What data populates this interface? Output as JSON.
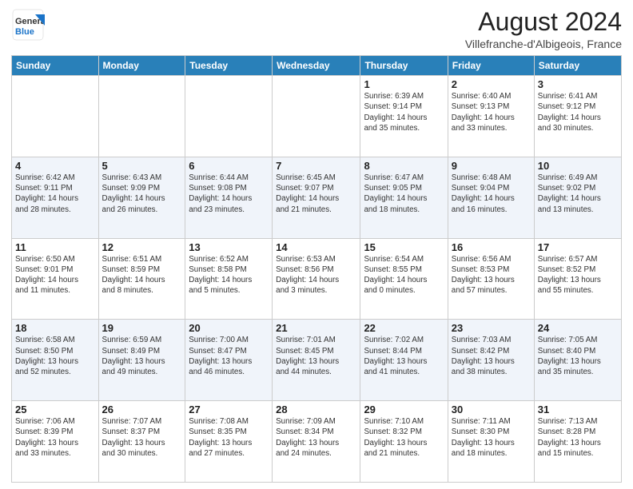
{
  "header": {
    "logo_general": "General",
    "logo_blue": "Blue",
    "month_title": "August 2024",
    "location": "Villefranche-d'Albigeois, France"
  },
  "calendar": {
    "days_of_week": [
      "Sunday",
      "Monday",
      "Tuesday",
      "Wednesday",
      "Thursday",
      "Friday",
      "Saturday"
    ],
    "weeks": [
      [
        {
          "day": "",
          "info": ""
        },
        {
          "day": "",
          "info": ""
        },
        {
          "day": "",
          "info": ""
        },
        {
          "day": "",
          "info": ""
        },
        {
          "day": "1",
          "info": "Sunrise: 6:39 AM\nSunset: 9:14 PM\nDaylight: 14 hours\nand 35 minutes."
        },
        {
          "day": "2",
          "info": "Sunrise: 6:40 AM\nSunset: 9:13 PM\nDaylight: 14 hours\nand 33 minutes."
        },
        {
          "day": "3",
          "info": "Sunrise: 6:41 AM\nSunset: 9:12 PM\nDaylight: 14 hours\nand 30 minutes."
        }
      ],
      [
        {
          "day": "4",
          "info": "Sunrise: 6:42 AM\nSunset: 9:11 PM\nDaylight: 14 hours\nand 28 minutes."
        },
        {
          "day": "5",
          "info": "Sunrise: 6:43 AM\nSunset: 9:09 PM\nDaylight: 14 hours\nand 26 minutes."
        },
        {
          "day": "6",
          "info": "Sunrise: 6:44 AM\nSunset: 9:08 PM\nDaylight: 14 hours\nand 23 minutes."
        },
        {
          "day": "7",
          "info": "Sunrise: 6:45 AM\nSunset: 9:07 PM\nDaylight: 14 hours\nand 21 minutes."
        },
        {
          "day": "8",
          "info": "Sunrise: 6:47 AM\nSunset: 9:05 PM\nDaylight: 14 hours\nand 18 minutes."
        },
        {
          "day": "9",
          "info": "Sunrise: 6:48 AM\nSunset: 9:04 PM\nDaylight: 14 hours\nand 16 minutes."
        },
        {
          "day": "10",
          "info": "Sunrise: 6:49 AM\nSunset: 9:02 PM\nDaylight: 14 hours\nand 13 minutes."
        }
      ],
      [
        {
          "day": "11",
          "info": "Sunrise: 6:50 AM\nSunset: 9:01 PM\nDaylight: 14 hours\nand 11 minutes."
        },
        {
          "day": "12",
          "info": "Sunrise: 6:51 AM\nSunset: 8:59 PM\nDaylight: 14 hours\nand 8 minutes."
        },
        {
          "day": "13",
          "info": "Sunrise: 6:52 AM\nSunset: 8:58 PM\nDaylight: 14 hours\nand 5 minutes."
        },
        {
          "day": "14",
          "info": "Sunrise: 6:53 AM\nSunset: 8:56 PM\nDaylight: 14 hours\nand 3 minutes."
        },
        {
          "day": "15",
          "info": "Sunrise: 6:54 AM\nSunset: 8:55 PM\nDaylight: 14 hours\nand 0 minutes."
        },
        {
          "day": "16",
          "info": "Sunrise: 6:56 AM\nSunset: 8:53 PM\nDaylight: 13 hours\nand 57 minutes."
        },
        {
          "day": "17",
          "info": "Sunrise: 6:57 AM\nSunset: 8:52 PM\nDaylight: 13 hours\nand 55 minutes."
        }
      ],
      [
        {
          "day": "18",
          "info": "Sunrise: 6:58 AM\nSunset: 8:50 PM\nDaylight: 13 hours\nand 52 minutes."
        },
        {
          "day": "19",
          "info": "Sunrise: 6:59 AM\nSunset: 8:49 PM\nDaylight: 13 hours\nand 49 minutes."
        },
        {
          "day": "20",
          "info": "Sunrise: 7:00 AM\nSunset: 8:47 PM\nDaylight: 13 hours\nand 46 minutes."
        },
        {
          "day": "21",
          "info": "Sunrise: 7:01 AM\nSunset: 8:45 PM\nDaylight: 13 hours\nand 44 minutes."
        },
        {
          "day": "22",
          "info": "Sunrise: 7:02 AM\nSunset: 8:44 PM\nDaylight: 13 hours\nand 41 minutes."
        },
        {
          "day": "23",
          "info": "Sunrise: 7:03 AM\nSunset: 8:42 PM\nDaylight: 13 hours\nand 38 minutes."
        },
        {
          "day": "24",
          "info": "Sunrise: 7:05 AM\nSunset: 8:40 PM\nDaylight: 13 hours\nand 35 minutes."
        }
      ],
      [
        {
          "day": "25",
          "info": "Sunrise: 7:06 AM\nSunset: 8:39 PM\nDaylight: 13 hours\nand 33 minutes."
        },
        {
          "day": "26",
          "info": "Sunrise: 7:07 AM\nSunset: 8:37 PM\nDaylight: 13 hours\nand 30 minutes."
        },
        {
          "day": "27",
          "info": "Sunrise: 7:08 AM\nSunset: 8:35 PM\nDaylight: 13 hours\nand 27 minutes."
        },
        {
          "day": "28",
          "info": "Sunrise: 7:09 AM\nSunset: 8:34 PM\nDaylight: 13 hours\nand 24 minutes."
        },
        {
          "day": "29",
          "info": "Sunrise: 7:10 AM\nSunset: 8:32 PM\nDaylight: 13 hours\nand 21 minutes."
        },
        {
          "day": "30",
          "info": "Sunrise: 7:11 AM\nSunset: 8:30 PM\nDaylight: 13 hours\nand 18 minutes."
        },
        {
          "day": "31",
          "info": "Sunrise: 7:13 AM\nSunset: 8:28 PM\nDaylight: 13 hours\nand 15 minutes."
        }
      ]
    ]
  }
}
